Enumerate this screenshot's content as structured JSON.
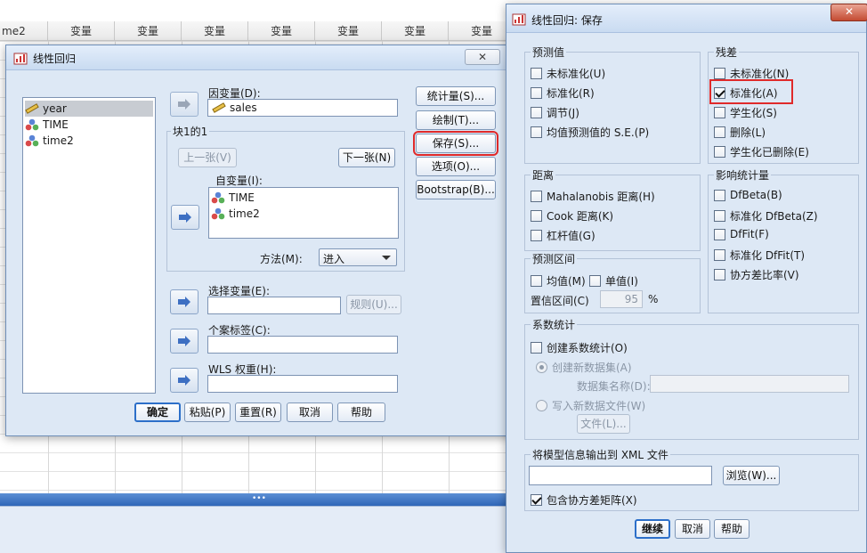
{
  "spreadsheet": {
    "first_col": "me2",
    "col_header": "变量",
    "col_count": 7
  },
  "regression": {
    "title": "线性回归",
    "close": "✕",
    "vars": [
      "year",
      "TIME",
      "time2"
    ],
    "dependent_label": "因变量(D):",
    "dependent_value": "sales",
    "block_label": "块1的1",
    "prev": "上一张(V)",
    "next": "下一张(N)",
    "independent_label": "自变量(I):",
    "independents": [
      "TIME",
      "time2"
    ],
    "method_label": "方法(M):",
    "method_value": "进入",
    "selection_label": "选择变量(E):",
    "rule": "规则(U)...",
    "case_label": "个案标签(C):",
    "wls_label": "WLS 权重(H):",
    "side_buttons": [
      "统计量(S)...",
      "绘制(T)...",
      "保存(S)...",
      "选项(O)...",
      "Bootstrap(B)..."
    ],
    "bottom_buttons": [
      "确定",
      "粘贴(P)",
      "重置(R)",
      "取消",
      "帮助"
    ]
  },
  "save": {
    "title": "线性回归: 保存",
    "close": "✕",
    "predicted": {
      "legend": "预测值",
      "items": [
        {
          "label": "未标准化(U)",
          "checked": false
        },
        {
          "label": "标准化(R)",
          "checked": false
        },
        {
          "label": "调节(J)",
          "checked": false
        },
        {
          "label": "均值预测值的 S.E.(P)",
          "checked": false
        }
      ]
    },
    "residuals": {
      "legend": "残差",
      "items": [
        {
          "label": "未标准化(N)",
          "checked": false
        },
        {
          "label": "标准化(A)",
          "checked": true
        },
        {
          "label": "学生化(S)",
          "checked": false
        },
        {
          "label": "删除(L)",
          "checked": false
        },
        {
          "label": "学生化已删除(E)",
          "checked": false
        }
      ]
    },
    "distances": {
      "legend": "距离",
      "items": [
        {
          "label": "Mahalanobis 距离(H)",
          "checked": false
        },
        {
          "label": "Cook 距离(K)",
          "checked": false
        },
        {
          "label": "杠杆值(G)",
          "checked": false
        }
      ]
    },
    "influence": {
      "legend": "影响统计量",
      "items": [
        {
          "label": "DfBeta(B)",
          "checked": false
        },
        {
          "label": "标准化 DfBeta(Z)",
          "checked": false
        },
        {
          "label": "DfFit(F)",
          "checked": false
        },
        {
          "label": "标准化 DfFit(T)",
          "checked": false
        },
        {
          "label": "协方差比率(V)",
          "checked": false
        }
      ]
    },
    "prediction_interval": {
      "legend": "预测区间",
      "mean": "均值(M)",
      "individual": "单值(I)",
      "ci_label": "置信区间(C)",
      "ci_value": "95",
      "pct": "%"
    },
    "coef": {
      "legend": "系数统计",
      "create": "创建系数统计(O)",
      "new_dataset": "创建新数据集(A)",
      "dataset_name": "数据集名称(D):",
      "new_file": "写入新数据文件(W)",
      "file_btn": "文件(L)..."
    },
    "xml": {
      "legend": "将模型信息输出到 XML 文件",
      "browse": "浏览(W)...",
      "include": "包含协方差矩阵(X)"
    },
    "buttons": [
      "继续",
      "取消",
      "帮助"
    ]
  },
  "colors": {
    "dialog_bg": "#dde8f5",
    "highlight": "#e02a2a",
    "accent": "#2c6fc9"
  }
}
